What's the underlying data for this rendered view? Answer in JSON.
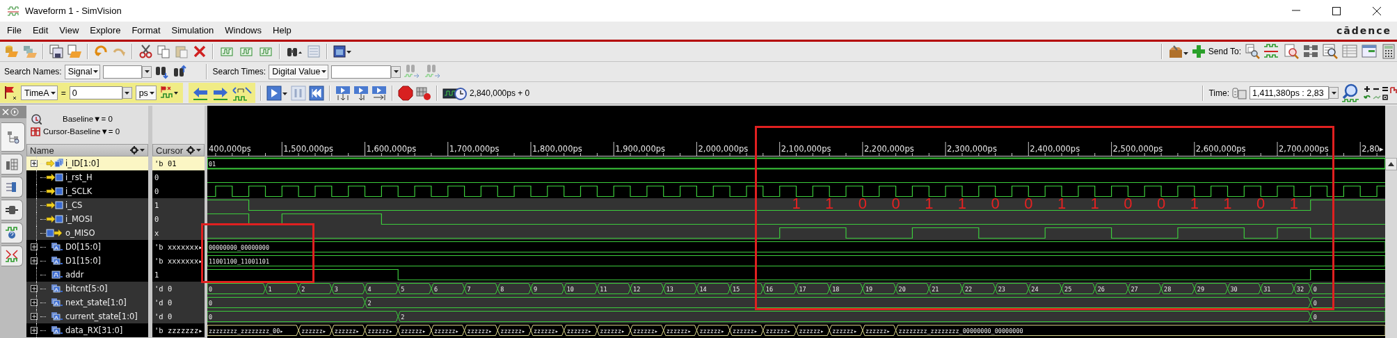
{
  "window": {
    "title": "Waveform 1 - SimVision"
  },
  "menu": [
    "File",
    "Edit",
    "View",
    "Explore",
    "Format",
    "Simulation",
    "Windows",
    "Help"
  ],
  "brand": "cādence",
  "toolbar": {
    "send_to": "Send To:"
  },
  "search": {
    "names_label": "Search Names:",
    "names_scope": "Signal",
    "times_label": "Search Times:",
    "times_scope": "Digital Value"
  },
  "time_bar": {
    "marker": "TimeA",
    "equals": "=",
    "value": "0",
    "unit": "ps",
    "sim_time": "2,840,000ps + 0",
    "time_label": "Time:",
    "range": "1,411,380ps : 2,83"
  },
  "baseline": {
    "baseline": "Baseline▼= 0",
    "cursor_baseline": "Cursor-Baseline▼= 0"
  },
  "columns": {
    "name": "Name",
    "cursor": "Cursor"
  },
  "timeline": [
    "400,000ps",
    "1,500,000ps",
    "1,600,000ps",
    "1,700,000ps",
    "1,800,000ps",
    "1,900,000ps",
    "2,000,000ps",
    "2,100,000ps",
    "2,200,000ps",
    "2,300,000ps",
    "2,400,000ps",
    "2,500,000ps",
    "2,600,000ps",
    "2,700,000ps",
    "2,80▸"
  ],
  "signals": [
    {
      "name": "i_ID[1:0]",
      "kind": "input_bus",
      "expanded": false,
      "selected": true,
      "cursor": "'b 01",
      "wave": {
        "kind": "bus",
        "undriven": false,
        "values": [
          "01"
        ]
      }
    },
    {
      "name": "i_rst_H",
      "kind": "input",
      "selected": false,
      "cursor": "0",
      "wave": {
        "kind": "trace"
      }
    },
    {
      "name": "i_SCLK",
      "kind": "input",
      "selected": false,
      "cursor": "0",
      "wave": {
        "kind": "trace"
      }
    },
    {
      "name": "i_CS",
      "kind": "input",
      "selected": false,
      "cursor": "1",
      "wave": {
        "kind": "trace"
      }
    },
    {
      "name": "i_MOSI",
      "kind": "input",
      "selected": false,
      "cursor": "0",
      "wave": {
        "kind": "trace"
      }
    },
    {
      "name": "o_MISO",
      "kind": "output",
      "selected": false,
      "cursor": "x",
      "wave": {
        "kind": "trace"
      }
    },
    {
      "name": "D0[15:0]",
      "kind": "bus",
      "expanded": false,
      "selected": false,
      "cursor": "'b xxxxxxx▸",
      "wave": {
        "kind": "bus",
        "undriven": false,
        "values": [
          "00000000_00000000"
        ]
      }
    },
    {
      "name": "D1[15:0]",
      "kind": "bus",
      "expanded": false,
      "selected": false,
      "cursor": "'b xxxxxxx▸",
      "wave": {
        "kind": "bus",
        "undriven": false,
        "values": [
          "11001100_11001101"
        ]
      }
    },
    {
      "name": "addr",
      "kind": "wire",
      "selected": false,
      "cursor": "1",
      "wave": {
        "kind": "trace"
      }
    },
    {
      "name": "bitcnt[5:0]",
      "kind": "bus",
      "expanded": false,
      "selected": false,
      "cursor": "'d 0",
      "wave": {
        "kind": "bus",
        "undriven": false,
        "values": [
          "0",
          "1",
          "2",
          "3",
          "4",
          "5",
          "6",
          "7",
          "8",
          "9",
          "10",
          "11",
          "12",
          "13",
          "14",
          "15",
          "16",
          "17",
          "18",
          "19",
          "20",
          "21",
          "22",
          "23",
          "24",
          "25",
          "26",
          "27",
          "28",
          "29",
          "30",
          "31",
          "32",
          "0"
        ]
      }
    },
    {
      "name": "next_state[1:0]",
      "kind": "bus",
      "expanded": false,
      "selected": false,
      "cursor": "'d 0",
      "wave": {
        "kind": "bus",
        "undriven": false,
        "values": [
          "0",
          "2",
          "0"
        ]
      }
    },
    {
      "name": "current_state[1:0]",
      "kind": "bus",
      "expanded": false,
      "selected": false,
      "cursor": "'d 0",
      "wave": {
        "kind": "bus",
        "undriven": false,
        "values": [
          "0",
          "2",
          "0"
        ]
      }
    },
    {
      "name": "data_RX[31:0]",
      "kind": "bus",
      "expanded": false,
      "selected": false,
      "cursor": "'b zzzzzzz▸",
      "wave": {
        "kind": "bus",
        "undriven": true,
        "values": [
          "zzzzzzzz_zzzzzzzz_00▸",
          "zzzzzz▸",
          "zzzzzz▸",
          "zzzzzz▸",
          "zzzzzz▸",
          "zzzzzz▸",
          "zzzzzz▸",
          "zzzzzz▸",
          "zzzzzz▸",
          "zzzzzz▸",
          "zzzzzz▸",
          "zzzzzz▸",
          "zzzzzz▸",
          "zzzzzz▸",
          "zzzzzz▸",
          "zzzzzz▸",
          "zzzzzz▸",
          "zzzzzz▸",
          "zzzzzz▸",
          "zzzzzzzz_zzzzzzzz_00000000_00000000"
        ]
      }
    }
  ],
  "annotation_bits": [
    "1",
    "1",
    "0",
    "0",
    "1",
    "1",
    "0",
    "0",
    "1",
    "1",
    "0",
    "0",
    "1",
    "1",
    "0",
    "1"
  ],
  "annotation_boxes": [
    {
      "kind": "box"
    },
    {
      "kind": "box"
    }
  ]
}
